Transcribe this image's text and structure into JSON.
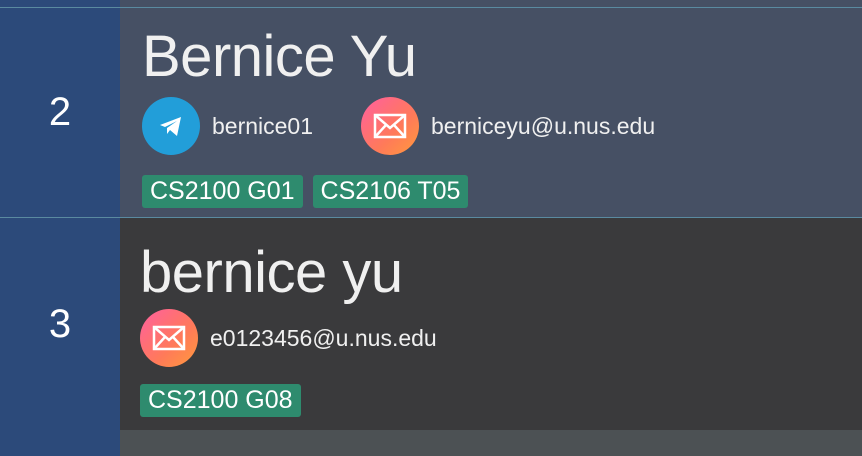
{
  "persons": [
    {
      "index": "2",
      "name": "Bernice Yu",
      "telegram": "bernice01",
      "email": "berniceyu@u.nus.edu",
      "tags": [
        "CS2100 G01",
        "CS2106 T05"
      ]
    },
    {
      "index": "3",
      "name": "bernice yu",
      "email": "e0123456@u.nus.edu",
      "tags": [
        "CS2100 G08"
      ]
    }
  ],
  "icons": {
    "telegram": "telegram-icon",
    "email": "envelope-icon"
  },
  "colors": {
    "index_bg": "#2c4a7a",
    "selected_card_bg": "#465064",
    "card_bg": "#3a3a3c",
    "tag_bg": "#2e8b6e",
    "telegram_blue": "#229ed9"
  }
}
